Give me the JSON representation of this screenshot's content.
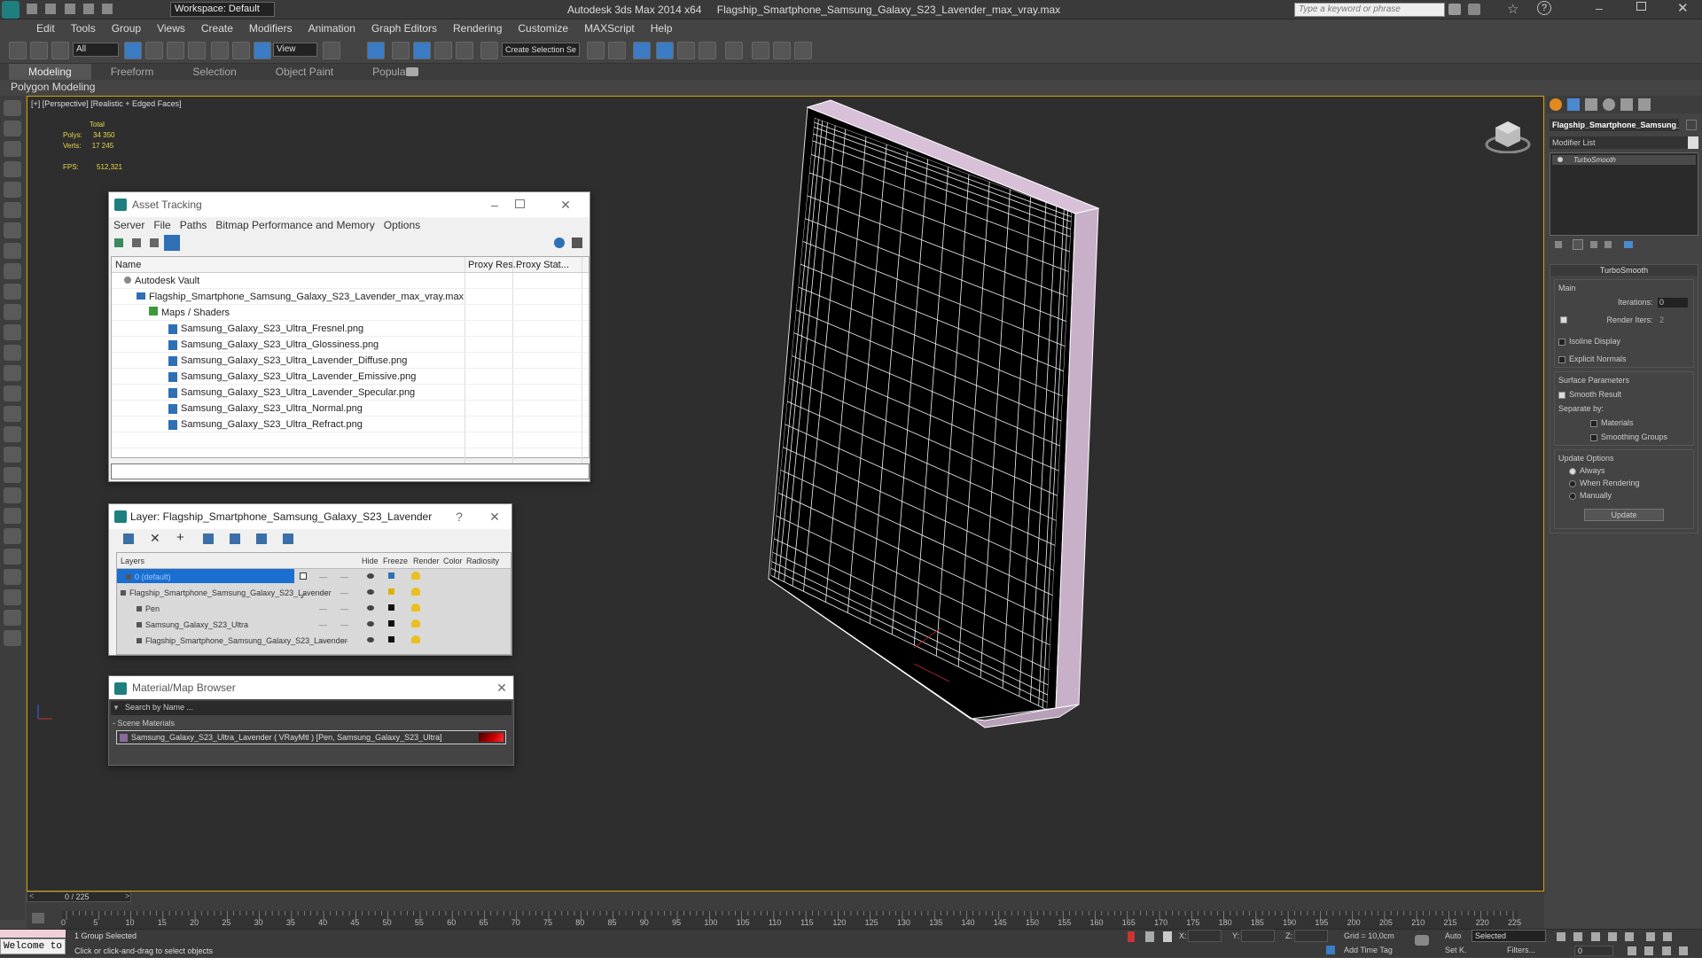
{
  "titlebar": {
    "workspace": "Workspace: Default",
    "app": "Autodesk 3ds Max  2014 x64",
    "file": "Flagship_Smartphone_Samsung_Galaxy_S23_Lavender_max_vray.max",
    "search_placeholder": "Type a keyword or phrase"
  },
  "menu": [
    "Edit",
    "Tools",
    "Group",
    "Views",
    "Create",
    "Modifiers",
    "Animation",
    "Graph Editors",
    "Rendering",
    "Customize",
    "MAXScript",
    "Help"
  ],
  "toolbar": {
    "filter": "All",
    "ref_coord": "View",
    "selection_set": "Create Selection Se"
  },
  "ribbon": {
    "tabs": [
      "Modeling",
      "Freeform",
      "Selection",
      "Object Paint",
      "Populate"
    ],
    "sub": "Polygon Modeling"
  },
  "viewport": {
    "label": "[+] [Perspective] [Realistic + Edged Faces]",
    "stats_total": "Total",
    "polys_label": "Polys:",
    "polys": "34 350",
    "verts_label": "Verts:",
    "verts": "17 245",
    "fps_label": "FPS:",
    "fps": "512,321"
  },
  "asset_tracking": {
    "title": "Asset Tracking",
    "menu": [
      "Server",
      "File",
      "Paths",
      "Bitmap Performance and Memory",
      "Options"
    ],
    "columns": [
      "Name",
      "Proxy Res...",
      "Proxy Stat..."
    ],
    "vault": "Autodesk Vault",
    "maxfile": "Flagship_Smartphone_Samsung_Galaxy_S23_Lavender_max_vray.max",
    "maps": "Maps / Shaders",
    "files": [
      "Samsung_Galaxy_S23_Ultra_Fresnel.png",
      "Samsung_Galaxy_S23_Ultra_Glossiness.png",
      "Samsung_Galaxy_S23_Ultra_Lavender_Diffuse.png",
      "Samsung_Galaxy_S23_Ultra_Lavender_Emissive.png",
      "Samsung_Galaxy_S23_Ultra_Lavender_Specular.png",
      "Samsung_Galaxy_S23_Ultra_Normal.png",
      "Samsung_Galaxy_S23_Ultra_Refract.png"
    ]
  },
  "layer": {
    "title": "Layer: Flagship_Smartphone_Samsung_Galaxy_S23_Lavender",
    "help": "?",
    "columns": [
      "Layers",
      "Hide",
      "Freeze",
      "Render",
      "Color",
      "Radiosity"
    ],
    "rows": [
      {
        "name": "0 (default)",
        "color": "#2e6fb5"
      },
      {
        "name": "Flagship_Smartphone_Samsung_Galaxy_S23_Lavender",
        "color": "#e0b000"
      },
      {
        "name": "Pen",
        "color": "#111111"
      },
      {
        "name": "Samsung_Galaxy_S23_Ultra",
        "color": "#111111"
      },
      {
        "name": "Flagship_Smartphone_Samsung_Galaxy_S23_Lavender",
        "color": "#111111"
      }
    ]
  },
  "material_browser": {
    "title": "Material/Map Browser",
    "search_placeholder": "Search by Name ...",
    "section": "- Scene Materials",
    "item": "Samsung_Galaxy_S23_Ultra_Lavender  ( VRayMtl ) [Pen, Samsung_Galaxy_S23_Ultra]"
  },
  "cmdpanel": {
    "object_name": "Flagship_Smartphone_Samsung_",
    "modifier_list": "Modifier List",
    "stack_item": "TurboSmooth",
    "rollout": "TurboSmooth",
    "main": "Main",
    "iterations_label": "Iterations:",
    "iterations": "0",
    "render_iters_label": "Render Iters:",
    "render_iters": "2",
    "isoline": "Isoline Display",
    "explicit": "Explicit Normals",
    "surface": "Surface Parameters",
    "smooth_result": "Smooth Result",
    "separate_by": "Separate by:",
    "materials": "Materials",
    "smoothing_groups": "Smoothing Groups",
    "update_options": "Update Options",
    "always": "Always",
    "when_rendering": "When Rendering",
    "manually": "Manually",
    "update_btn": "Update"
  },
  "timeline": {
    "frame": "0 / 225",
    "ticks": [
      "0",
      "5",
      "10",
      "15",
      "20",
      "25",
      "30",
      "35",
      "40",
      "45",
      "50",
      "55",
      "60",
      "65",
      "70",
      "75",
      "80",
      "85",
      "90",
      "95",
      "100",
      "105",
      "110",
      "115",
      "120",
      "125",
      "130",
      "135",
      "140",
      "145",
      "150",
      "155",
      "160",
      "165",
      "170",
      "175",
      "180",
      "185",
      "190",
      "195",
      "200",
      "205",
      "210",
      "215",
      "220",
      "225"
    ]
  },
  "status": {
    "welcome": "Welcome to",
    "selected": "1 Group Selected",
    "prompt": "Click or click-and-drag to select objects",
    "x_label": "X:",
    "y_label": "Y:",
    "z_label": "Z:",
    "grid": "Grid = 10,0cm",
    "add_time_tag": "Add Time Tag",
    "auto": "Auto",
    "set_key": "Set K.",
    "selected_dd": "Selected",
    "filters": "Filters...",
    "frame_field": "0"
  }
}
